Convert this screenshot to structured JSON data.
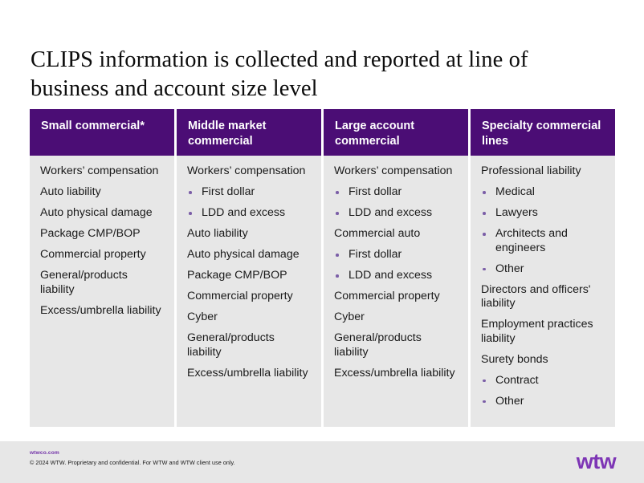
{
  "slide": {
    "title": "CLIPS information is collected and reported at line of business and account size level"
  },
  "colors": {
    "header_purple": "#4B0D75",
    "body_gray": "#E7E7E7",
    "bullet_purple": "#7B5EA7",
    "logo_purple": "#7D35B5",
    "link_purple": "#7232A8"
  },
  "table": {
    "columns": [
      {
        "header": "Small commercial*",
        "items": [
          {
            "text": "Workers’ compensation",
            "level": 0
          },
          {
            "text": "Auto liability",
            "level": 0
          },
          {
            "text": "Auto physical damage",
            "level": 0
          },
          {
            "text": "Package CMP/BOP",
            "level": 0
          },
          {
            "text": "Commercial property",
            "level": 0
          },
          {
            "text": "General/products liability",
            "level": 0
          },
          {
            "text": "Excess/umbrella liability",
            "level": 0
          }
        ]
      },
      {
        "header": "Middle market commercial",
        "items": [
          {
            "text": "Workers’ compensation",
            "level": 0
          },
          {
            "text": "First dollar",
            "level": 1
          },
          {
            "text": "LDD and excess",
            "level": 1
          },
          {
            "text": "Auto liability",
            "level": 0
          },
          {
            "text": "Auto physical damage",
            "level": 0
          },
          {
            "text": "Package CMP/BOP",
            "level": 0
          },
          {
            "text": "Commercial property",
            "level": 0
          },
          {
            "text": "Cyber",
            "level": 0
          },
          {
            "text": "General/products liability",
            "level": 0
          },
          {
            "text": "Excess/umbrella liability",
            "level": 0
          }
        ]
      },
      {
        "header": "Large account commercial",
        "items": [
          {
            "text": "Workers’ compensation",
            "level": 0
          },
          {
            "text": "First dollar",
            "level": 1
          },
          {
            "text": "LDD and excess",
            "level": 1
          },
          {
            "text": "Commercial auto",
            "level": 0
          },
          {
            "text": "First dollar",
            "level": 1
          },
          {
            "text": "LDD and excess",
            "level": 1
          },
          {
            "text": "Commercial property",
            "level": 0
          },
          {
            "text": "Cyber",
            "level": 0
          },
          {
            "text": "General/products liability",
            "level": 0
          },
          {
            "text": "Excess/umbrella liability",
            "level": 0
          }
        ]
      },
      {
        "header": "Specialty commercial lines",
        "items": [
          {
            "text": "Professional liability",
            "level": 0
          },
          {
            "text": "Medical",
            "level": 1
          },
          {
            "text": "Lawyers",
            "level": 1
          },
          {
            "text": "Architects and engineers",
            "level": 1
          },
          {
            "text": "Other",
            "level": 1
          },
          {
            "text": "Directors and officers' liability",
            "level": 0
          },
          {
            "text": "Employment practices liability",
            "level": 0
          },
          {
            "text": "Surety bonds",
            "level": 0
          },
          {
            "text": "Contract",
            "level": 1
          },
          {
            "text": "Other",
            "level": 1
          }
        ]
      }
    ]
  },
  "footer": {
    "url": "wtwco.com",
    "copyright": "© 2024 WTW. Proprietary and confidential. For WTW and WTW client use only.",
    "logo_text": "wtw"
  }
}
